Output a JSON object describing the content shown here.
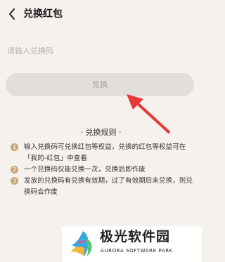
{
  "header": {
    "title": "兑换红包",
    "back_icon": "chevron-left-icon"
  },
  "redeem_input": {
    "value": "",
    "placeholder": "请输入兑换码"
  },
  "redeem_button": {
    "label": "兑换"
  },
  "rules": {
    "title": "· 兑换规则 ·",
    "items": [
      {
        "num": "1",
        "text": "输入兑换码可兑换红包等权益，兑换的红包等权益可在「我的-红包」中查看"
      },
      {
        "num": "2",
        "text": "一个兑换码仅能兑换一次，兑换后即作废"
      },
      {
        "num": "3",
        "text": "发放的兑换码有兑换有效期，过了有效期后未兑换，则兑换码会作废"
      }
    ]
  },
  "watermark": {
    "cn": "极光软件园",
    "en": "AURORA SOFTWARE PARK"
  },
  "colors": {
    "background": "#f5f1ec",
    "button_bg": "#e2deda",
    "button_text": "#a7a29d",
    "rule_number_bg": "#c9a57a",
    "annotation_arrow": "#e8373a"
  }
}
